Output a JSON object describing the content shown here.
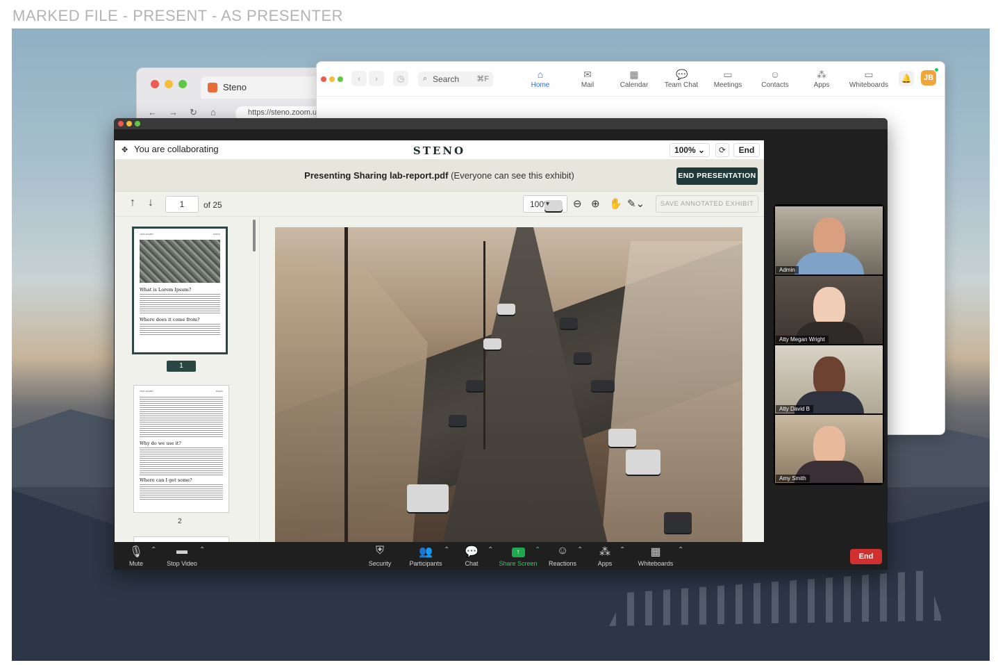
{
  "frame_title": "MARKED FILE - PRESENT - AS PRESENTER",
  "browser": {
    "tab_title": "Steno",
    "url": "https://steno.zoom.u",
    "nav": {
      "back": "←",
      "forward": "→",
      "reload": "↻",
      "home": "⌂",
      "lock": "🔒"
    }
  },
  "zoom_app": {
    "search_label": "Search",
    "search_shortcut": "⌘F",
    "tabs": [
      {
        "label": "Home",
        "icon": "home-icon",
        "glyph": "⌂"
      },
      {
        "label": "Mail",
        "icon": "mail-icon",
        "glyph": "✉"
      },
      {
        "label": "Calendar",
        "icon": "calendar-icon",
        "glyph": "▦"
      },
      {
        "label": "Team Chat",
        "icon": "team-chat-icon",
        "glyph": "💬"
      },
      {
        "label": "Meetings",
        "icon": "meetings-icon",
        "glyph": "▭"
      },
      {
        "label": "Contacts",
        "icon": "contacts-icon",
        "glyph": "☺"
      },
      {
        "label": "Apps",
        "icon": "apps-icon",
        "glyph": "⁂"
      },
      {
        "label": "Whiteboards",
        "icon": "whiteboards-icon",
        "glyph": "▭"
      }
    ],
    "avatar_initials": "JB",
    "bell": "🔔"
  },
  "steno": {
    "collab_text": "You are collaborating",
    "brand": "STENO",
    "zoom_select": "100% ⌄",
    "end_label": "End",
    "presenting_prefix": "Presenting Sharing lab-report.pdf",
    "presenting_suffix": " (Everyone can see this exhibit)",
    "end_presentation": "END PRESENTATION",
    "page_value": "1",
    "page_of": "of 25",
    "zoom_level": "100%",
    "save_annotated": "SAVE ANNOTATED EXHIBIT",
    "thumbnails": [
      {
        "page_label": "1",
        "heading1": "What is Lorem Ipsum?",
        "heading2": "Where does it come from?",
        "hdr_left": "TEST EXHIBIT",
        "hdr_right": "STENO"
      },
      {
        "page_label": "2",
        "heading1": "Why do we use it?",
        "heading2": "Where can I get some?",
        "hdr_left": "TEST EXHIBIT",
        "hdr_right": "STENO"
      }
    ]
  },
  "participants": [
    {
      "name": "Admin"
    },
    {
      "name": "Atty Megan Wright"
    },
    {
      "name": "Atty David B"
    },
    {
      "name": "Amy Smith"
    }
  ],
  "controls": {
    "mute": "Mute",
    "stop_video": "Stop Video",
    "security": "Security",
    "participants": "Participants",
    "chat": "Chat",
    "share_screen": "Share Screen",
    "reactions": "Reactions",
    "apps": "Apps",
    "whiteboards": "Whiteboards",
    "end": "End"
  },
  "colors": {
    "accent_blue": "#2d6ae3",
    "steno_dark": "#1f3a38",
    "end_red": "#d1312e",
    "share_green": "#39c56a"
  }
}
